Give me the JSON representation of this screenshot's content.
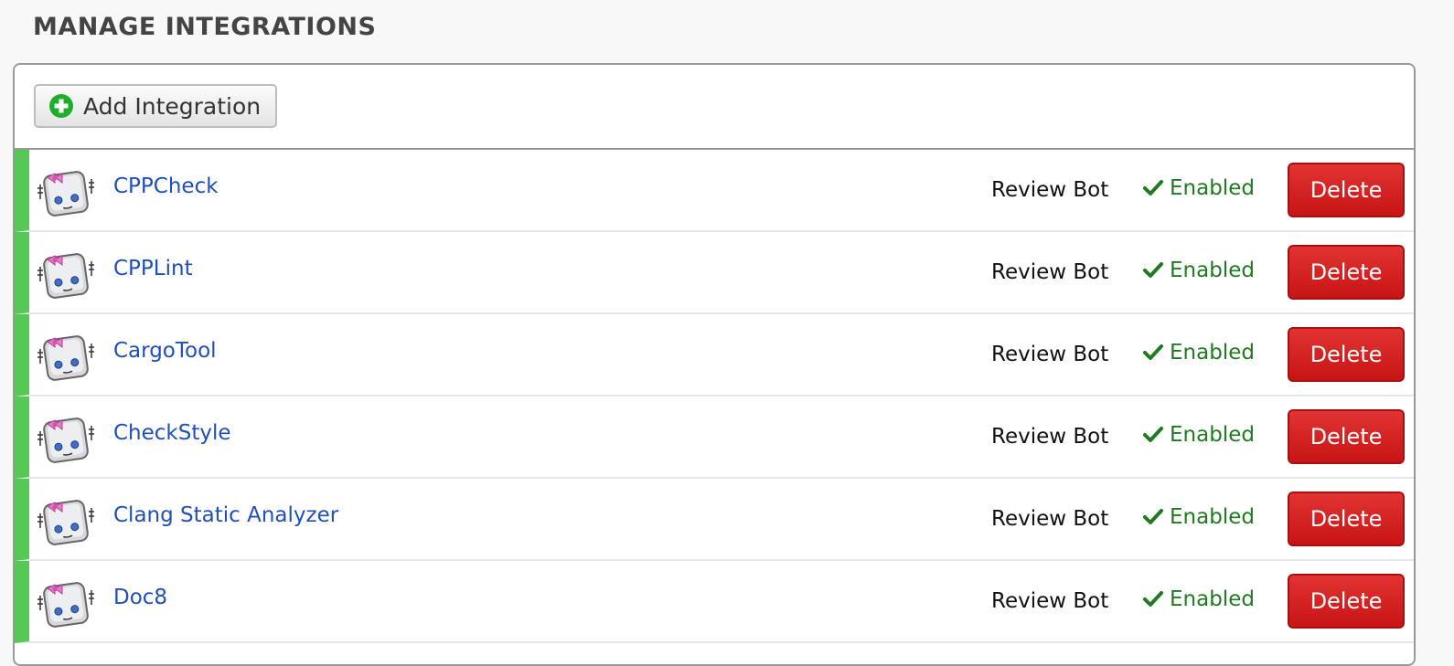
{
  "page": {
    "title": "MANAGE INTEGRATIONS"
  },
  "toolbar": {
    "add_label": "Add Integration",
    "add_icon": "plus-circle-icon"
  },
  "colors": {
    "accent_bar": "#55c855",
    "link": "#1f4fb8",
    "enabled": "#207a20",
    "delete": "#d11f1f"
  },
  "integrations": [
    {
      "name": "CPPCheck",
      "type": "Review Bot",
      "status": "Enabled",
      "delete_label": "Delete",
      "icon": "review-bot-robot-icon"
    },
    {
      "name": "CPPLint",
      "type": "Review Bot",
      "status": "Enabled",
      "delete_label": "Delete",
      "icon": "review-bot-robot-icon"
    },
    {
      "name": "CargoTool",
      "type": "Review Bot",
      "status": "Enabled",
      "delete_label": "Delete",
      "icon": "review-bot-robot-icon"
    },
    {
      "name": "CheckStyle",
      "type": "Review Bot",
      "status": "Enabled",
      "delete_label": "Delete",
      "icon": "review-bot-robot-icon"
    },
    {
      "name": "Clang Static Analyzer",
      "type": "Review Bot",
      "status": "Enabled",
      "delete_label": "Delete",
      "icon": "review-bot-robot-icon"
    },
    {
      "name": "Doc8",
      "type": "Review Bot",
      "status": "Enabled",
      "delete_label": "Delete",
      "icon": "review-bot-robot-icon"
    }
  ]
}
